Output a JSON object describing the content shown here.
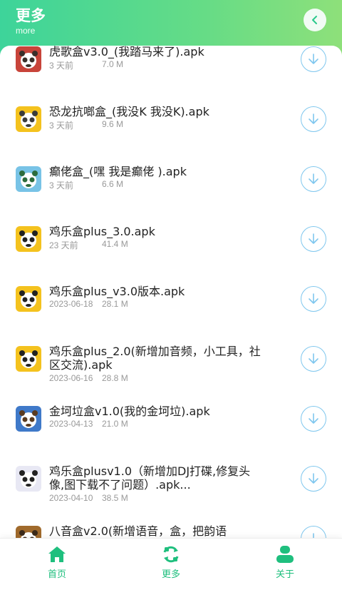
{
  "header": {
    "title": "更多",
    "subtitle": "more"
  },
  "items": [
    {
      "name": "虎歌盒v3.0_(我踏马来了).apk",
      "age": "3 天前",
      "size": "7.0 M",
      "icon": "app-icon-huge",
      "colors": [
        "#c8443a",
        "#3a2f2a"
      ]
    },
    {
      "name": "恐龙抗啷盒_(我没K 我没K).apk",
      "age": "3 天前",
      "size": "9.6 M",
      "icon": "app-icon-dinosaur",
      "colors": [
        "#f4c21e",
        "#3b3b3b"
      ]
    },
    {
      "name": "癫佬盒_(嘿 我是癫佬 ).apk",
      "age": "3 天前",
      "size": "6.6 M",
      "icon": "app-icon-dianlao",
      "colors": [
        "#78c3e6",
        "#2d6c3c"
      ]
    },
    {
      "name": "鸡乐盒plus_3.0.apk",
      "age": "23 天前",
      "size": "41.4 M",
      "icon": "app-icon-panda",
      "colors": [
        "#f4c21e",
        "#222222"
      ]
    },
    {
      "name": "鸡乐盒plus_v3.0版本.apk",
      "age": "2023-06-18",
      "size": "28.1 M",
      "icon": "app-icon-panda",
      "colors": [
        "#f4c21e",
        "#222222"
      ]
    },
    {
      "name": "鸡乐盒plus_2.0(新增加音频，小工具，社区交流).apk",
      "age": "2023-06-16",
      "size": "28.8 M",
      "icon": "app-icon-panda",
      "colors": [
        "#f4c21e",
        "#222222"
      ]
    },
    {
      "name": "金坷垃盒v1.0(我的金坷垃).apk",
      "age": "2023-04-13",
      "size": "21.0 M",
      "icon": "app-icon-jinkela",
      "colors": [
        "#3f79c9",
        "#5a3b20"
      ]
    },
    {
      "name": "鸡乐盒plusv1.0（新增加DJ打碟,修复头像,图下载不了问题）.apk...",
      "age": "2023-04-10",
      "size": "38.5 M",
      "icon": "app-icon-panda",
      "colors": [
        "#e8e8f4",
        "#222222"
      ]
    },
    {
      "name": "八音盒v2.0(新增语音，盒，把韵语",
      "age": "",
      "size": "",
      "icon": "app-icon-bayin",
      "colors": [
        "#a06a2c",
        "#3b2a1a"
      ]
    }
  ],
  "nav": [
    {
      "label": "首页",
      "icon": "home-icon"
    },
    {
      "label": "更多",
      "icon": "swap-icon"
    },
    {
      "label": "关于",
      "icon": "user-icon"
    }
  ],
  "accent": "#1fbf7e",
  "download_color": "#7fc7ee"
}
